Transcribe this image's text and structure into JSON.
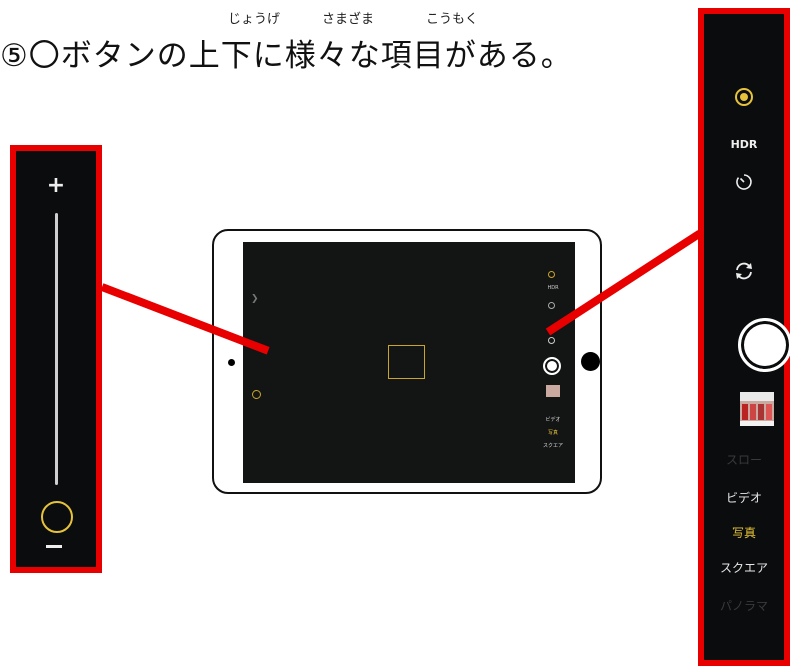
{
  "heading": {
    "text": "⑤〇ボタンの上下に様々な項目がある。",
    "ruby_jouge": "じょうげ",
    "ruby_samazama": "さまざま",
    "ruby_koumoku": "こうもく"
  },
  "zoom_panel": {
    "plus_label": "+",
    "level": 0.0
  },
  "mode_panel": {
    "hdr_label": "HDR",
    "modes": [
      {
        "label": "スロー",
        "state": "dim"
      },
      {
        "label": "ビデオ",
        "state": "normal"
      },
      {
        "label": "写真",
        "state": "selected"
      },
      {
        "label": "スクエア",
        "state": "normal"
      },
      {
        "label": "パノラマ",
        "state": "dim"
      }
    ]
  },
  "ipad_screen": {
    "hdr_label": "HDR",
    "modes": [
      "ビデオ",
      "写真",
      "スクエア"
    ]
  },
  "colors": {
    "callout": "#e80000",
    "accent": "#e6c33a",
    "panel_bg": "#0b0c0d",
    "mode_dim": "#3a3a3a"
  }
}
